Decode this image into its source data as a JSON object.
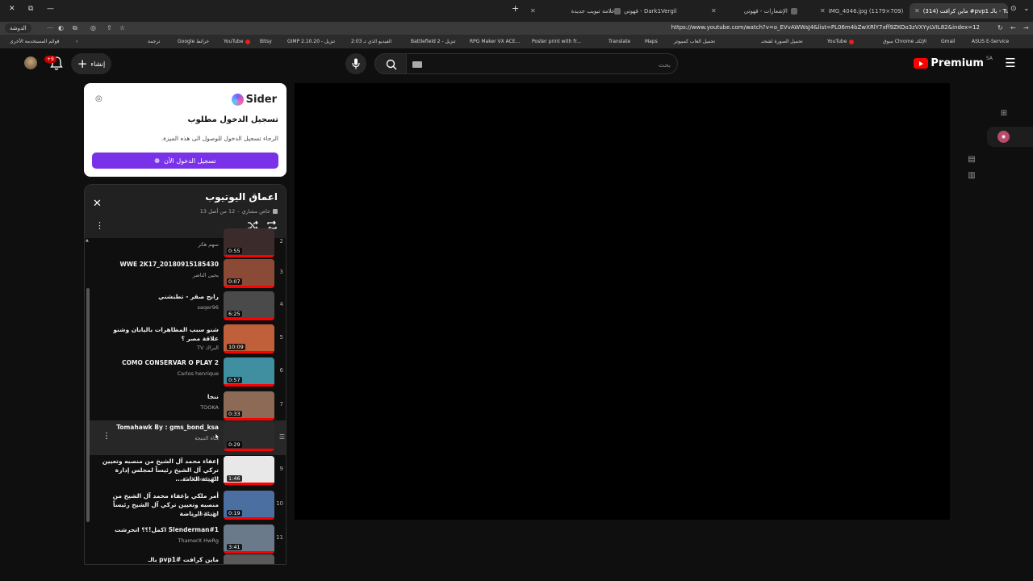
{
  "browser": {
    "tabs": [
      {
        "label": "(314) ماين كرافت #pvp1 بالـ - Tube",
        "active": true
      },
      {
        "label": "IMG_4046.jpg (1179×709)",
        "active": false
      },
      {
        "label": "الإشعارات - قهوتي",
        "active": false
      },
      {
        "label": "قهوتي - Dark1Vergil",
        "active": false
      },
      {
        "label": "علامة تبويب جديدة",
        "active": false
      }
    ],
    "url": "https://www.youtube.com/watch?v=o_EVvAWWsJ4&list=PL06m4bZwXRlY7xff9ZKOo3zVXYyLVIL82&index=12",
    "profile_chip": "الدوشة",
    "bookmarks": [
      "ASUS E-Service",
      "Gmail",
      "سوق Chrome الإلكتـ",
      "YouTube",
      "تحميل الصورة لشحنـ",
      "تحميل العاب كمبيوتر",
      "Maps",
      "Translate",
      "Poster print with fr...",
      "RPG Maker VX ACE...",
      "Battlefield 2 - تنزيل",
      "2:03 الفيديو الذي تـ",
      "GIMP 2.10.20 - تنزيل",
      "Bitsy",
      "YouTube",
      "Google خرائط",
      "ترجمة",
      "قوائم المستخدمة الأخرى"
    ]
  },
  "header": {
    "logo_text": "Premium",
    "country": "SA",
    "search_placeholder": "بحث",
    "create_label": "إنشاء",
    "bell_badge": "+9"
  },
  "sider": {
    "brand": "Sider",
    "title": "تسجيل الدخول مطلوب",
    "desc": "الرجاء تسجيل الدخول للوصول الى هذه الميزة.",
    "button": "تسجيل الدخول الآن"
  },
  "playlist": {
    "title": "اعماق اليوتيوب",
    "owner": "خاص  مشاري",
    "position": "12 من أصل 13",
    "items": [
      {
        "index": "2",
        "title": "",
        "channel": "سهم هكر",
        "duration": "0:55",
        "thumb": "#3b2b2b",
        "current": false
      },
      {
        "index": "3",
        "title": "WWE 2K17_20180915185430",
        "channel": "يحيى الناصر",
        "duration": "0:07",
        "thumb": "#8a4a36",
        "current": false
      },
      {
        "index": "4",
        "title": "رابح صقر - تطنشني",
        "channel": "saqer96",
        "duration": "6:25",
        "thumb": "#4a4a4a",
        "current": false
      },
      {
        "index": "5",
        "title": "شنو سبب المظاهرات باليابان وشنو علاقة مصر ؟",
        "channel": "البراك TV",
        "duration": "10:09",
        "thumb": "#c0603a",
        "current": false
      },
      {
        "index": "6",
        "title": "COMO CONSERVAR O PLAY 2",
        "channel": "Carlos henrique",
        "duration": "0:57",
        "thumb": "#3f8fa0",
        "current": false
      },
      {
        "index": "7",
        "title": "ننجا",
        "channel": "TOOKA",
        "duration": "0:33",
        "thumb": "#8c6a55",
        "current": false
      },
      {
        "index": "",
        "title": "Tomahawk By : gms_bond_ksa",
        "channel": "قناة النتيجة",
        "duration": "0:29",
        "thumb": "#2b2b2b",
        "current": true
      },
      {
        "index": "9",
        "title": "إعفاء محمد آل الشيخ من منصبه وتعيين تركي آل الشيخ رئيساً لمجلس إدارة الهيئة العامة...",
        "channel": "Gulf news TV",
        "duration": "1:46",
        "thumb": "#e8e8e8",
        "current": false
      },
      {
        "index": "10",
        "title": "أمر ملكي بإعفاء محمد آل الشيخ من منصبه وتعيين تركي آل الشيخ رئيساً لهيئة الرياضة",
        "channel": "قناة الإخبارية",
        "duration": "0:19",
        "thumb": "#4a6fa0",
        "current": false
      },
      {
        "index": "11",
        "title": "Slenderman#1 اكمل!؟؟ اتحرشت",
        "channel": "ThamerX HwRg",
        "duration": "3:41",
        "thumb": "#6a7a8a",
        "current": false
      },
      {
        "index": "",
        "title": "ماين كرافت #pvp1 بالـ",
        "channel": "",
        "duration": "",
        "thumb": "#5a5a5a",
        "current": false
      }
    ]
  },
  "colors": {
    "accent_red": "#ff0000",
    "sider_purple": "#7a32e8",
    "background": "#0f0f0f"
  }
}
